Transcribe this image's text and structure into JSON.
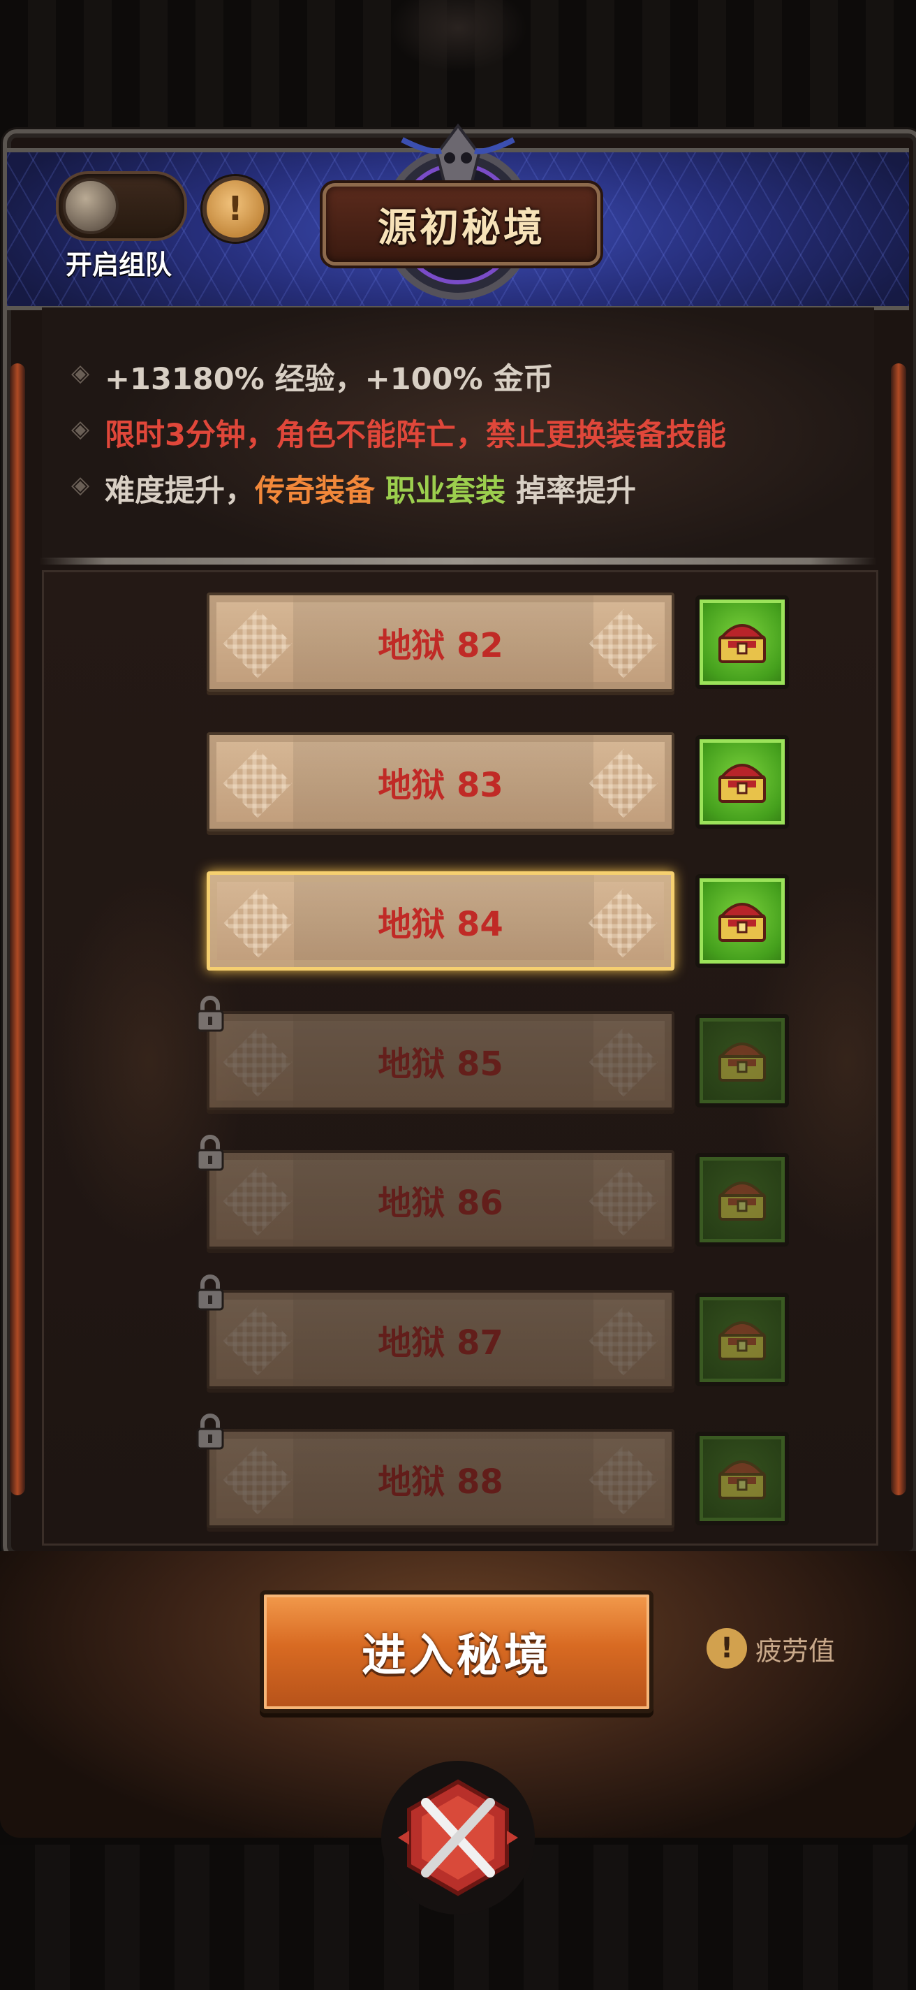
{
  "header": {
    "title": "源初秘境",
    "team_toggle_label": "开启组队",
    "info_icon": "!"
  },
  "description": {
    "line1": "+13180% 经验，+100% 金币",
    "line2": "限时3分钟，角色不能阵亡，禁止更换装备技能",
    "line3_prefix": "难度提升，",
    "line3_legendary": "传奇装备",
    "line3_set": "职业套装",
    "line3_suffix": "掉率提升"
  },
  "levels": [
    {
      "label": "地狱 82",
      "state": "unlocked"
    },
    {
      "label": "地狱 83",
      "state": "unlocked"
    },
    {
      "label": "地狱 84",
      "state": "selected"
    },
    {
      "label": "地狱 85",
      "state": "locked"
    },
    {
      "label": "地狱 86",
      "state": "locked"
    },
    {
      "label": "地狱 87",
      "state": "locked"
    },
    {
      "label": "地狱 88",
      "state": "locked"
    }
  ],
  "enter_button": "进入秘境",
  "fatigue": {
    "icon": "!",
    "label": "疲劳值"
  },
  "colors": {
    "title_text": "#f7e2b8",
    "warning_red": "#e0473a",
    "legendary_orange": "#f2883a",
    "set_green": "#9ccf4e",
    "level_text_red": "#c02a26",
    "selected_border": "#f6d070",
    "chest_green": "#5cbf2a",
    "enter_button_orange": "#d86a22"
  },
  "icons": {
    "chest": "treasure-chest-icon",
    "lock": "padlock-icon",
    "emblem": "crossed-swords-emblem-icon",
    "badge": "skull-icon"
  }
}
